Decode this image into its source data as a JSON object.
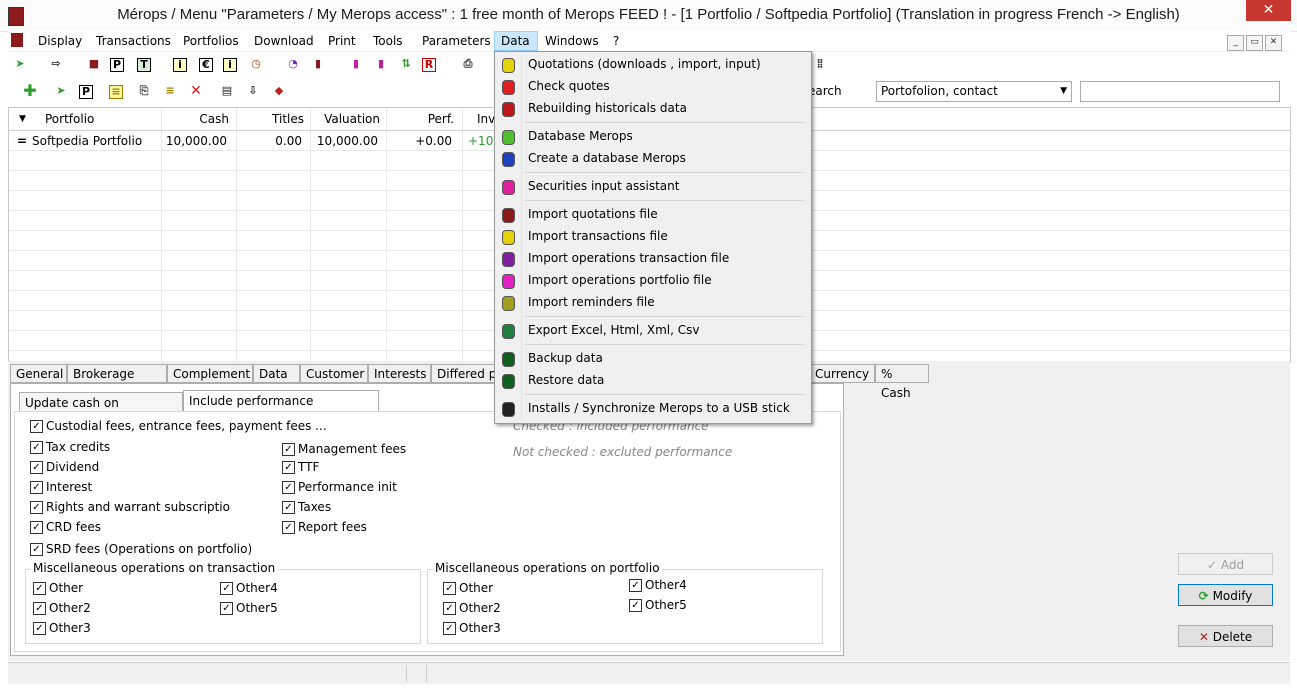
{
  "window": {
    "title": "Mérops / Menu \"Parameters / My Merops access\" : 1 free month of Merops FEED ! - [1 Portfolio / Softpedia Portfolio] (Translation in progress French -> English)",
    "close_glyph": "✕"
  },
  "menu": {
    "items": [
      "Display",
      "Transactions",
      "Portfolios",
      "Download",
      "Print",
      "Tools",
      "Parameters",
      "Data",
      "Windows",
      "?"
    ],
    "active": "Data",
    "mdi_buttons": [
      "_",
      "▭",
      "✕"
    ]
  },
  "toolbar1": {
    "icons": [
      "tag-icon",
      "export-icon",
      "book-icon",
      "p-icon",
      "t-icon",
      "info-icon",
      "euro-icon",
      "info2-icon",
      "clock-icon",
      "pie-icon",
      "bar-icon",
      "city-icon",
      "city2-icon",
      "arrows-icon",
      "r-icon",
      "printer-icon"
    ],
    "glyphs": [
      "➤",
      "⇨",
      "■",
      "P",
      "T",
      "i",
      "€",
      "i",
      "◷",
      "◔",
      "▮",
      "▮",
      "▮",
      "⇅",
      "R",
      "⎙"
    ]
  },
  "toolbar2": {
    "icons": [
      "add-icon",
      "tag-icon",
      "p-icon",
      "note-icon",
      "clip-icon",
      "list-icon",
      "delete-icon",
      "doc-icon",
      "sort-icon",
      "eraser-icon"
    ],
    "glyphs": [
      "✚",
      "➤",
      "P",
      "≡",
      "⎘",
      "≡",
      "✕",
      "▤",
      "⇩",
      "◆"
    ]
  },
  "search": {
    "label": "earch",
    "select_value": "Portofolion, contact",
    "arrow": "▼",
    "text_value": ""
  },
  "grid": {
    "sort_arrow": "▼",
    "columns": [
      "Portfolio",
      "Cash",
      "Titles",
      "Valuation",
      "Perf.",
      "Inv"
    ],
    "rows": [
      {
        "marker": "=",
        "portfolio": "Softpedia Portfolio",
        "cash": "10,000.00",
        "titles": "0.00",
        "valuation": "10,000.00",
        "perf": "+0.00",
        "inv": "+10,"
      }
    ]
  },
  "tabs": [
    "General",
    "Brokerage fees",
    "Complement",
    "Data",
    "Customer",
    "Interests",
    "Differed p",
    "Currency",
    "% Cash"
  ],
  "subtabs": [
    "Update cash on operations",
    "Include performance operations"
  ],
  "checkboxes_left": [
    {
      "label": "Custodial fees, entrance fees, payment fees ...",
      "checked": true
    },
    {
      "label": "Tax credits",
      "checked": true
    },
    {
      "label": "Dividend",
      "checked": true
    },
    {
      "label": "Interest",
      "checked": true
    },
    {
      "label": "Rights and warrant subscriptio",
      "checked": true
    },
    {
      "label": "CRD fees",
      "checked": true
    },
    {
      "label": "SRD fees (Operations on portfolio)",
      "checked": true
    }
  ],
  "checkboxes_mid": [
    {
      "label": "Management fees",
      "checked": true
    },
    {
      "label": "TTF",
      "checked": true
    },
    {
      "label": "Performance init",
      "checked": true
    },
    {
      "label": "Taxes",
      "checked": true
    },
    {
      "label": "Report fees",
      "checked": true
    }
  ],
  "notes": {
    "checked": "Checked : included performance",
    "not_checked": "Not checked : excluted performance"
  },
  "group_transaction": {
    "title": "Miscellaneous operations on transaction",
    "items": [
      "Other",
      "Other4",
      "Other2",
      "Other5",
      "Other3"
    ]
  },
  "group_portfolio": {
    "title": "Miscellaneous operations on portfolio",
    "items": [
      "Other",
      "Other4",
      "Other2",
      "Other5",
      "Other3"
    ]
  },
  "buttons": {
    "add": "Add",
    "modify": "Modify",
    "delete": "Delete",
    "add_glyph": "✓",
    "modify_glyph": "⟳",
    "delete_glyph": "✕"
  },
  "check_glyph": "✓",
  "data_menu": [
    {
      "label": "Quotations  (downloads , import, input)",
      "icon": "quotations-icon",
      "color": "#e6d20a"
    },
    {
      "label": "Check quotes",
      "icon": "check-quotes-icon",
      "color": "#e02020"
    },
    {
      "label": "Rebuilding historicals data",
      "icon": "rebuild-icon",
      "color": "#c01818"
    },
    {
      "sep": true
    },
    {
      "label": "Database Merops",
      "icon": "database-icon",
      "color": "#50c030"
    },
    {
      "label": "Create a database Merops",
      "icon": "create-db-icon",
      "color": "#2040c0"
    },
    {
      "sep": true
    },
    {
      "label": "Securities input assistant",
      "icon": "assistant-icon",
      "color": "#e020a0"
    },
    {
      "sep": true
    },
    {
      "label": "Import quotations file",
      "icon": "import-quotations-icon",
      "color": "#8b1a1a"
    },
    {
      "label": "Import transactions file",
      "icon": "import-transactions-icon",
      "color": "#e6d20a"
    },
    {
      "label": "Import operations transaction file",
      "icon": "import-op-transaction-icon",
      "color": "#8020a0"
    },
    {
      "label": "Import operations portfolio file",
      "icon": "import-op-portfolio-icon",
      "color": "#e020c0"
    },
    {
      "label": "Import reminders file",
      "icon": "import-reminders-icon",
      "color": "#a0a020"
    },
    {
      "sep": true
    },
    {
      "label": "Export Excel, Html, Xml, Csv",
      "icon": "excel-icon",
      "color": "#208040"
    },
    {
      "sep": true
    },
    {
      "label": "Backup data",
      "icon": "backup-icon",
      "color": "#106020"
    },
    {
      "label": "Restore data",
      "icon": "restore-icon",
      "color": "#106020"
    },
    {
      "sep": true
    },
    {
      "label": "Installs / Synchronize Merops to a USB stick",
      "icon": "usb-icon",
      "color": "#222222"
    }
  ]
}
